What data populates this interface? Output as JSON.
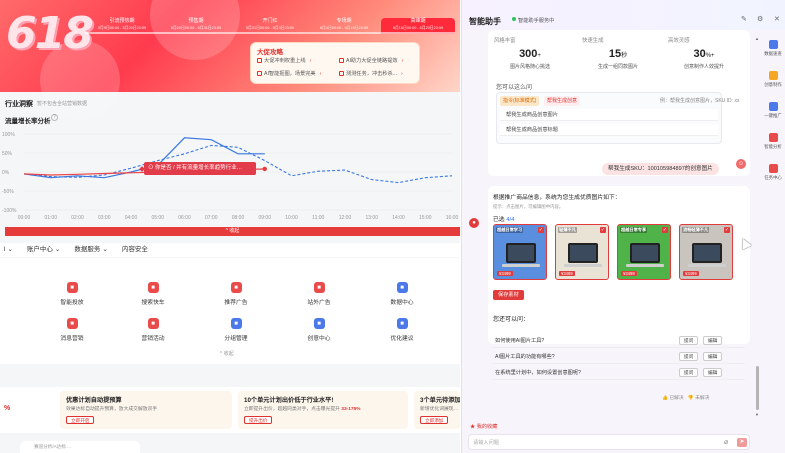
{
  "banner": {
    "logo": "618",
    "stages": [
      {
        "label": "引流预热期",
        "date": "5月9日00:00 - 5月20日23:59"
      },
      {
        "label": "预售期",
        "date": "5月20日00:00 - 5月31日23:59"
      },
      {
        "label": "开门红",
        "date": "5月31日00:00 - 6月3日23:59"
      },
      {
        "label": "专场期",
        "date": "6月4日00:00 - 6月15日23:59"
      },
      {
        "label": "高峰期",
        "date": "6月16日00:00 - 6月20日23:59"
      }
    ],
    "strategy_title": "大促攻略",
    "strategy_items": [
      "大促冲刺权重上线",
      "AI助力大促全链路提效",
      "AI智能抠图，场景完美",
      "测测任务，冲击秒杀..."
    ]
  },
  "section": {
    "title": "行业洞察",
    "subtitle": "暂不包含全站营销数据",
    "chart_title": "流量增长率分析",
    "tip": "?",
    "chart_banner": "⊙ 你是否 / 并有流量增长率趋势行业…",
    "collapse": "^ 收起"
  },
  "chart_data": {
    "type": "line",
    "x": [
      "00:00",
      "01:00",
      "02:00",
      "03:00",
      "04:00",
      "05:00",
      "06:00",
      "07:00",
      "08:00",
      "09:00",
      "10:00",
      "11:00",
      "12:00",
      "13:00",
      "14:00",
      "15:00",
      "16:00"
    ],
    "yticks": [
      "100%",
      "50%",
      "0%",
      "-50%",
      "-100%"
    ],
    "ylim": [
      -100,
      100
    ],
    "series": [
      {
        "values": [
          -5,
          -15,
          -10,
          -15,
          0,
          18,
          90,
          85,
          48,
          48,
          null,
          null,
          null,
          null,
          null,
          null,
          null
        ],
        "style": "solid",
        "color": "#3a78e0"
      },
      {
        "values": [
          -5,
          -12,
          -14,
          -8,
          10,
          30,
          48,
          70,
          65,
          30,
          -10,
          2,
          5,
          -20,
          -28,
          -15,
          -10
        ],
        "style": "dashed",
        "color": "#3a78e0"
      },
      {
        "values": [
          -5,
          -8,
          -6,
          -4,
          -2,
          0,
          2,
          4,
          6,
          8,
          null,
          null,
          null,
          null,
          null,
          null,
          null
        ],
        "style": "solid",
        "color": "#ee4444"
      }
    ],
    "colors": {
      "line": "#3a78e0",
      "accent": "#e63b3b"
    }
  },
  "nav": {
    "items": [
      "账户中心",
      "数据服务",
      "内容安全"
    ],
    "leading": "l"
  },
  "tools": [
    {
      "label": "智能投放",
      "icon": "chat-icon",
      "color": "#e94b4b"
    },
    {
      "label": "搜索快车",
      "icon": "car-icon",
      "color": "#e94b4b"
    },
    {
      "label": "推荐广告",
      "icon": "thumbs-up-icon",
      "color": "#e94b4b"
    },
    {
      "label": "站外广告",
      "icon": "share-icon",
      "color": "#e94b4b"
    },
    {
      "label": "数据中心",
      "icon": "chart-icon",
      "color": "#4b79e9"
    },
    {
      "label": "消息营销",
      "icon": "mail-icon",
      "color": "#e94b4b"
    },
    {
      "label": "营销活动",
      "icon": "flag-icon",
      "color": "#e94b4b"
    },
    {
      "label": "分组管理",
      "icon": "folder-icon",
      "color": "#4b79e9"
    },
    {
      "label": "创意中心",
      "icon": "palette-icon",
      "color": "#4b79e9"
    },
    {
      "label": "优化建议",
      "icon": "shield-icon",
      "color": "#4b79e9"
    }
  ],
  "tools_collapse": "^ 收起",
  "promos": [
    {
      "title": "优惠计划自动提预算",
      "desc": "效果达标自动提升预算，放大成交解放双手",
      "highlight": "",
      "button": "立即开启"
    },
    {
      "title": "10个单元计划出价低于行业水平!",
      "desc": "立即提升出价，超越同类对手，点击曝光提升",
      "highlight": "33-175%",
      "button": "提升出价"
    },
    {
      "title": "3个单元待添加",
      "desc": "新增优化词展现…",
      "highlight": "",
      "button": "立即添加"
    }
  ],
  "pct_left": "%",
  "bottom_bar": "赛道分析/A达标 ...",
  "panel": {
    "title": "智能助手",
    "status": "智能助手服务中",
    "stats": [
      {
        "label": "风格丰富",
        "value": "300",
        "suffix": "+",
        "desc": "图片风格随心挑选"
      },
      {
        "label": "快速生成",
        "value": "15",
        "suffix": "秒",
        "desc": "生成一组同款图片"
      },
      {
        "label": "高效灵感",
        "value": "30",
        "suffix": "%+",
        "desc": "创意制作人效提升"
      }
    ],
    "ask_label": "您可以这么问",
    "chips": [
      "指令(标准模式)",
      "帮我生成创意"
    ],
    "chip_hint": "例：帮我生成创意图片，SKU ID: xx",
    "ask_rows": [
      "帮我生成商品创意图片",
      "帮我生成商品创意标题"
    ],
    "user_message": "帮我生成SKU：100105984897的创意图片",
    "reply": "根据推广商品信息，系统为您生成优质图片如下：",
    "reply_hint": "提示：点击图片，可编辑图中内容。",
    "selected_prefix": "已选",
    "selected_count": "4/4",
    "thumbs": [
      {
        "top": "超越日常学习",
        "price": "¥3499",
        "bg": "#5a8fe0"
      },
      {
        "top": "轻薄不凡",
        "price": "¥3499",
        "bg": "#e9e3d6"
      },
      {
        "top": "超越日常专享",
        "price": "¥3499",
        "bg": "#4fb34a"
      },
      {
        "top": "流畅轻薄不凡",
        "price": "¥3499",
        "bg": "#c9c4be"
      }
    ],
    "save_button": "保存素材",
    "also_label": "您还可以问：",
    "questions": [
      "如何使用AI图片工具?",
      "AI图片工具的功能有哪些?",
      "在系统里计划中，如何设置创意图呢?"
    ],
    "ask_button": "提问",
    "edit_button": "编辑",
    "resolved": "已解决",
    "unresolved": "未解决",
    "favorite": "我的收藏",
    "input_placeholder": "请输入问题",
    "side": [
      {
        "label": "数据速查",
        "color": "#4b79e9"
      },
      {
        "label": "创意制作",
        "color": "#f5a623"
      },
      {
        "label": "一键推广",
        "color": "#4b79e9"
      },
      {
        "label": "智能分析",
        "color": "#e94b4b"
      },
      {
        "label": "任务中心",
        "color": "#e94b4b"
      }
    ]
  }
}
